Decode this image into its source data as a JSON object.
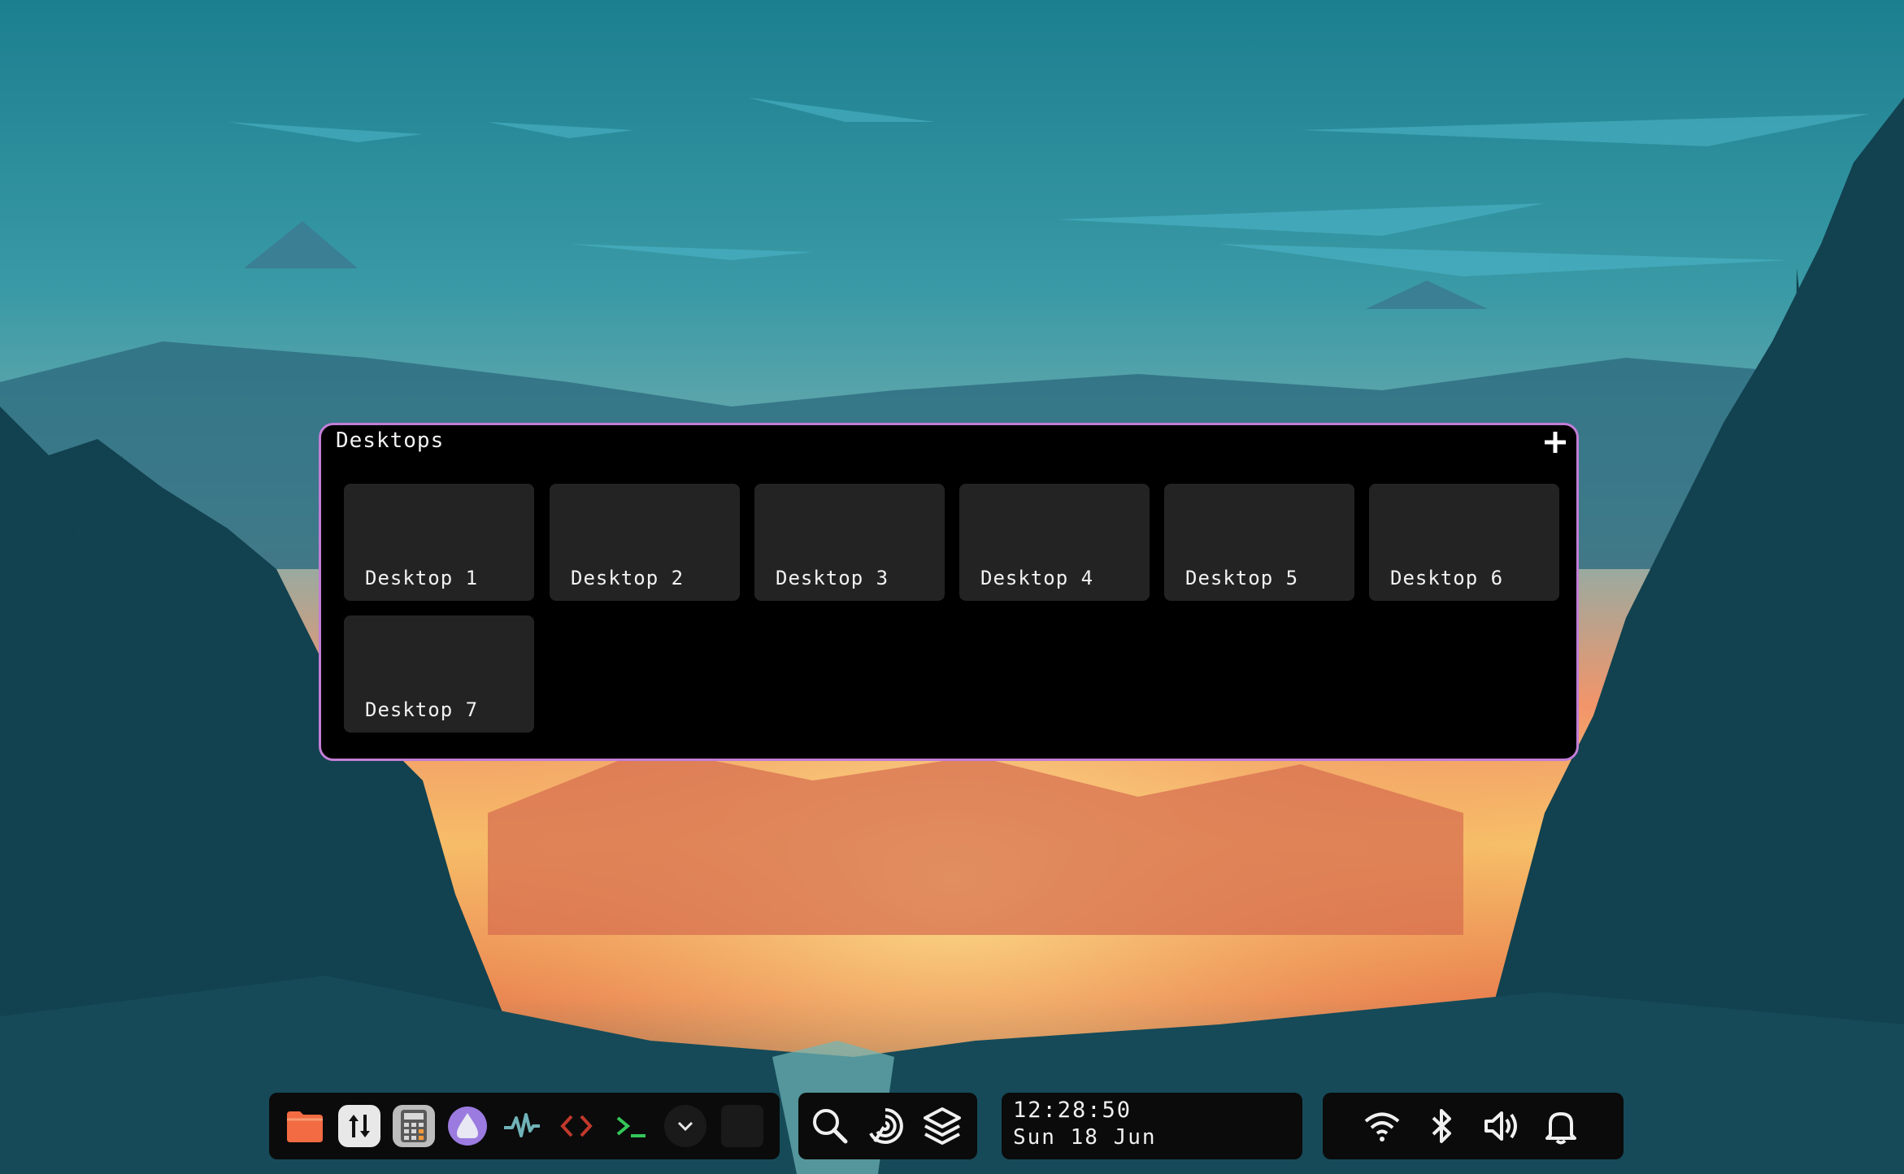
{
  "desktops_panel": {
    "title": "Desktops",
    "add_icon": "plus-icon",
    "desktops": [
      {
        "label": "Desktop 1"
      },
      {
        "label": "Desktop 2"
      },
      {
        "label": "Desktop 3"
      },
      {
        "label": "Desktop 4"
      },
      {
        "label": "Desktop 5"
      },
      {
        "label": "Desktop 6"
      },
      {
        "label": "Desktop 7"
      }
    ]
  },
  "taskbar": {
    "apps": [
      {
        "name": "files",
        "icon": "folder-icon",
        "color": "#f26b43"
      },
      {
        "name": "transfer",
        "icon": "up-down-arrows-icon",
        "color": "#e8e8e8"
      },
      {
        "name": "calculator",
        "icon": "calculator-icon",
        "color": "#7c7c7c"
      },
      {
        "name": "shell",
        "icon": "drop-icon",
        "color": "#9b7be0"
      },
      {
        "name": "monitor",
        "icon": "activity-icon",
        "color": "#6fb3b8"
      },
      {
        "name": "code-editor",
        "icon": "code-icon",
        "color": "#c0392b"
      },
      {
        "name": "terminal",
        "icon": "terminal-icon",
        "color": "#34c759"
      },
      {
        "name": "more",
        "icon": "chevron-down-icon",
        "color": "#e8e8e8"
      }
    ],
    "tools": [
      {
        "name": "search",
        "icon": "search-icon"
      },
      {
        "name": "assistant",
        "icon": "swirl-icon"
      },
      {
        "name": "workspaces",
        "icon": "layers-icon"
      }
    ],
    "clock": {
      "time": "12:28:50",
      "date": "Sun 18 Jun"
    },
    "tray": [
      {
        "name": "wifi",
        "icon": "wifi-icon"
      },
      {
        "name": "bluetooth",
        "icon": "bluetooth-icon"
      },
      {
        "name": "volume",
        "icon": "volume-icon"
      },
      {
        "name": "notifications",
        "icon": "bell-icon"
      }
    ]
  },
  "colors": {
    "panel_border": "#c27ed6",
    "tile_bg": "#232323",
    "bar_bg": "#0b0b0b"
  }
}
